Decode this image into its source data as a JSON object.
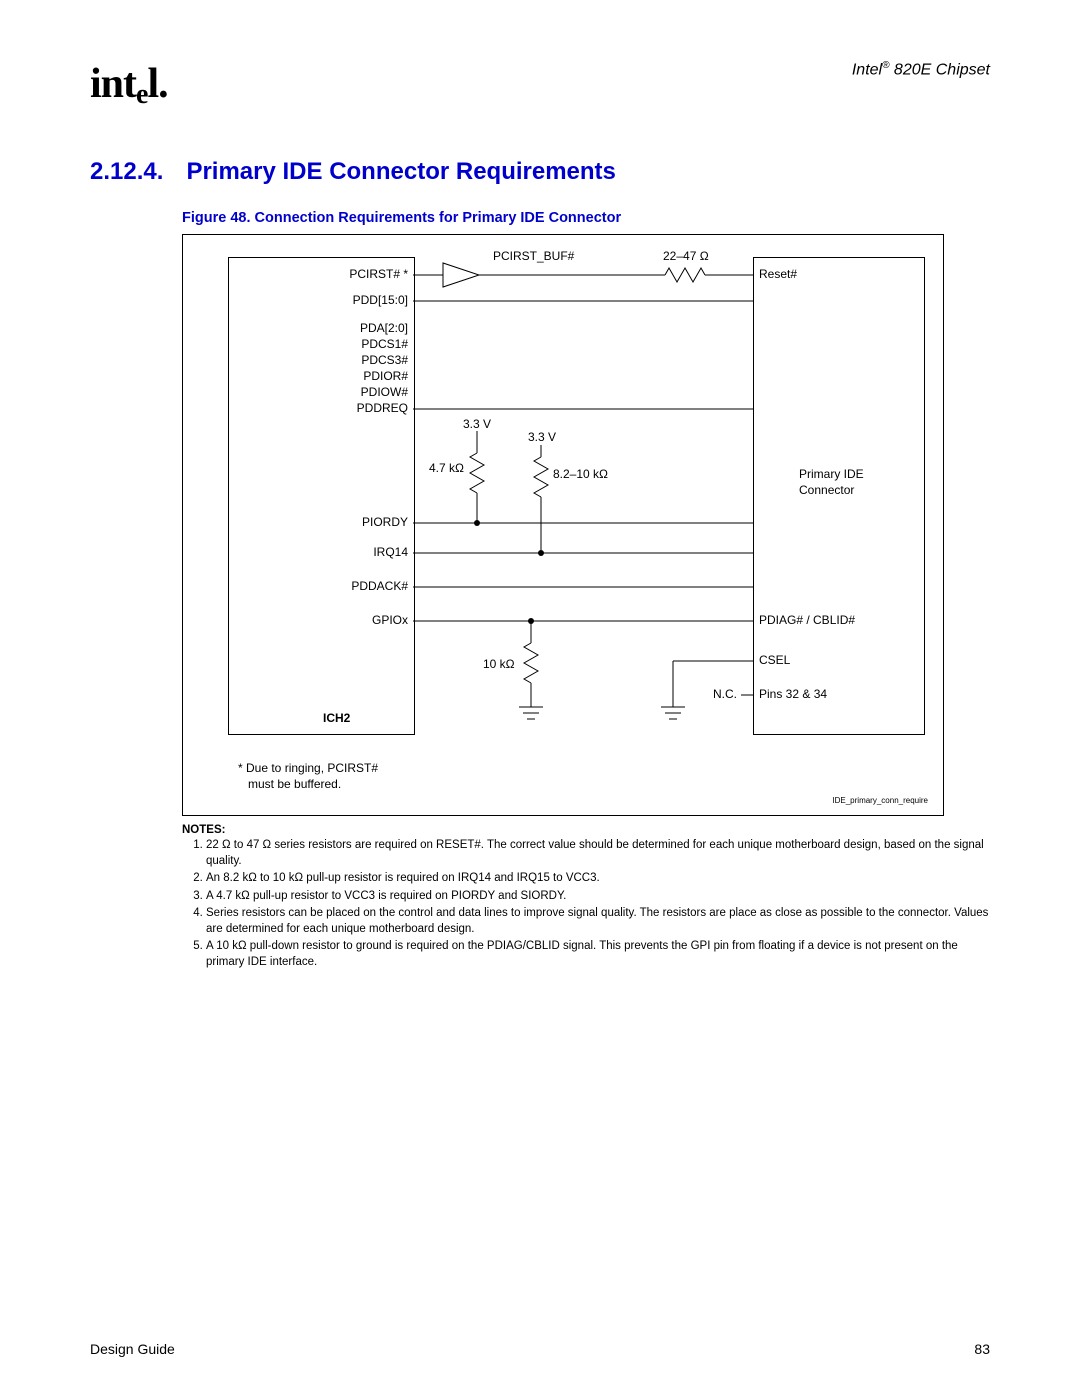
{
  "header": {
    "logo": "intel",
    "doc_title_prefix": "Intel",
    "doc_title_suffix": " 820E Chipset"
  },
  "section": {
    "number": "2.12.4.",
    "title": "Primary IDE Connector Requirements"
  },
  "figure": {
    "caption": "Figure 48. Connection Requirements for Primary IDE Connector"
  },
  "diagram": {
    "left_block_label": "ICH2",
    "left_signals": {
      "pcirst": "PCIRST# *",
      "pdd": "PDD[15:0]",
      "pda": "PDA[2:0]",
      "pdcs1": "PDCS1#",
      "pdcs3": "PDCS3#",
      "pdior": "PDIOR#",
      "pdiow": "PDIOW#",
      "pddreq": "PDDREQ",
      "piordy": "PIORDY",
      "irq14": "IRQ14",
      "pddack": "PDDACK#",
      "gpiox": "GPIOx"
    },
    "mid_labels": {
      "pcirst_buf": "PCIRST_BUF#",
      "r1_value": "22–47 Ω",
      "v1": "3.3 V",
      "v2": "3.3 V",
      "r2_value": "4.7 kΩ",
      "r3_value": "8.2–10 kΩ",
      "r4_value": "10 kΩ",
      "nc": "N.C."
    },
    "right_block": {
      "reset": "Reset#",
      "connector_label1": "Primary IDE",
      "connector_label2": "Connector",
      "pdiag": "PDIAG# / CBLID#",
      "csel": "CSEL",
      "pins": "Pins 32 & 34"
    },
    "footnote_line1": "* Due to ringing, PCIRST#",
    "footnote_line2": "must be buffered.",
    "diagram_id": "IDE_primary_conn_require"
  },
  "notes": {
    "heading": "NOTES:",
    "items": [
      "22 Ω to 47 Ω series resistors are required on RESET#. The correct value should be determined for each unique motherboard design, based on the signal quality.",
      "An 8.2 kΩ to 10 kΩ pull-up resistor is required on IRQ14 and IRQ15 to VCC3.",
      "A 4.7 kΩ pull-up resistor to VCC3 is required on PIORDY and SIORDY.",
      "Series resistors can be placed on the control and data lines to improve signal quality. The resistors are place as close as possible to the connector. Values are determined for each unique motherboard design.",
      "A 10 kΩ pull-down resistor to ground is required on the PDIAG/CBLID signal. This prevents the GPI pin from floating if a device is not present on the primary IDE interface."
    ]
  },
  "footer": {
    "left": "Design Guide",
    "right": "83"
  }
}
